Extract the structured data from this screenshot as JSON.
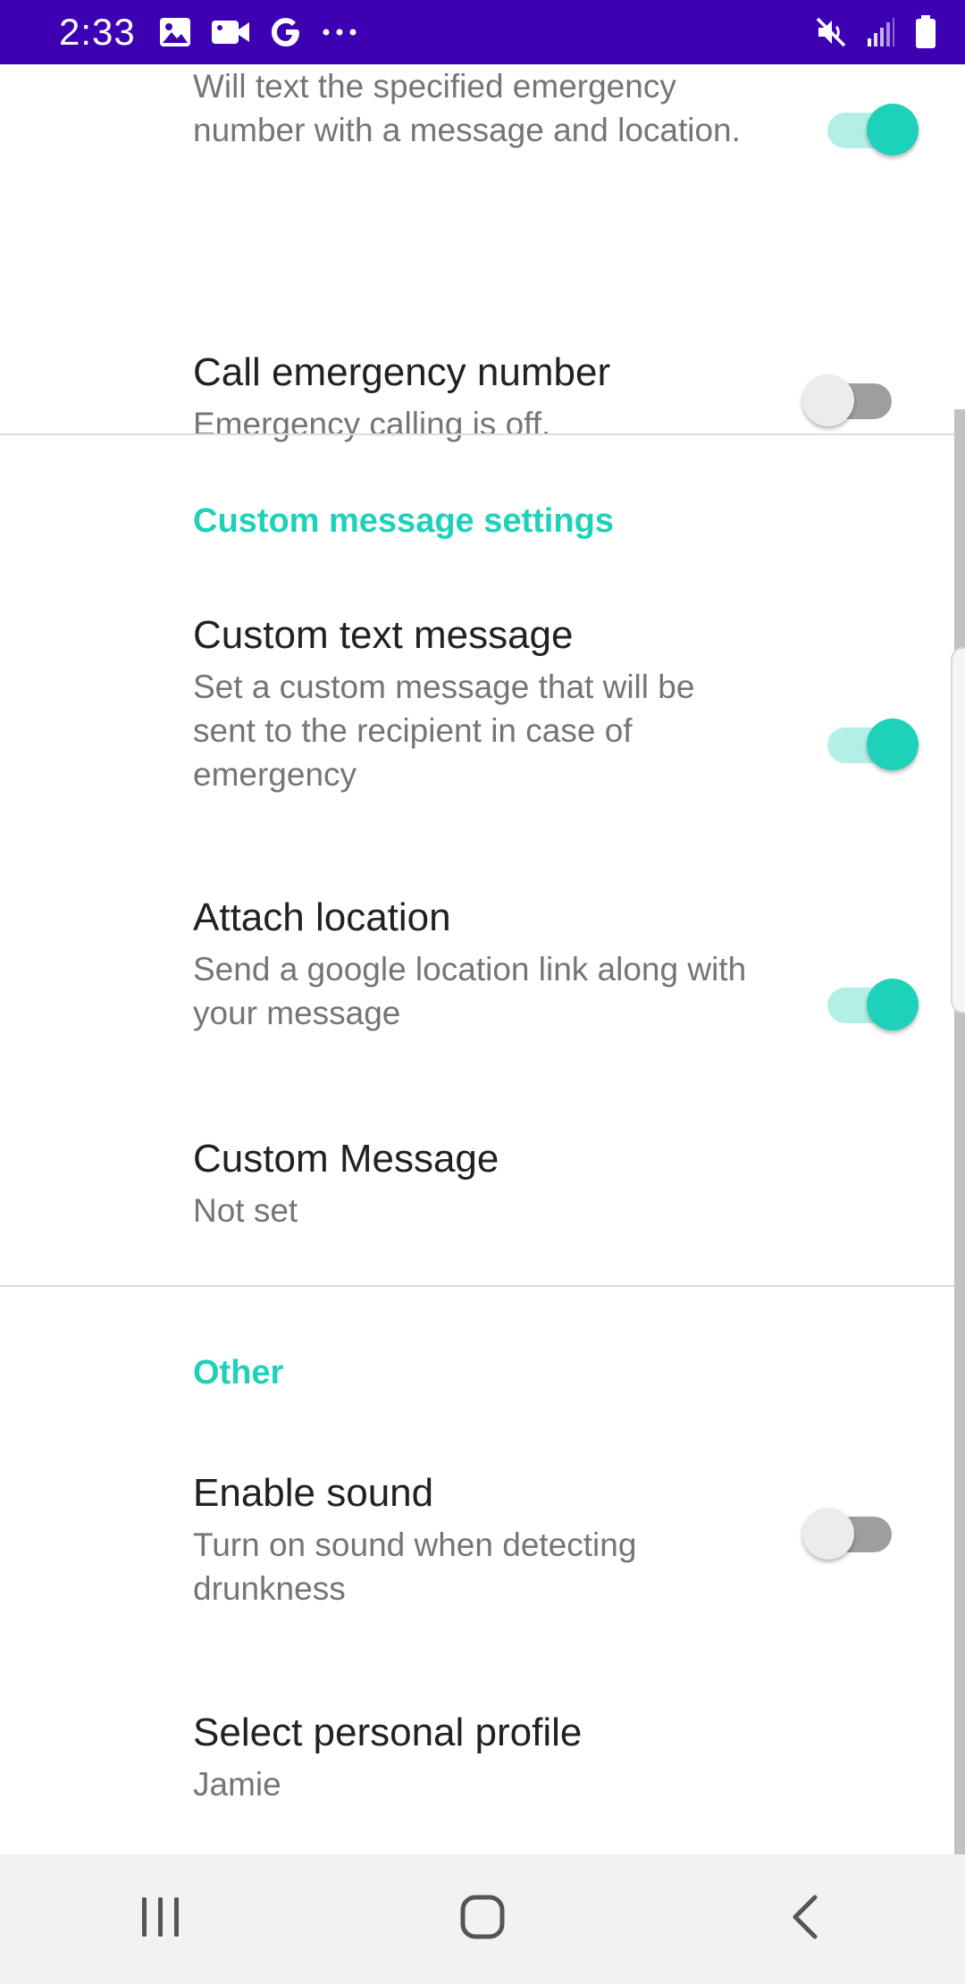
{
  "status_bar": {
    "time": "2:33",
    "left_icons": [
      "image-icon",
      "video-icon",
      "google-icon",
      "more-icon"
    ],
    "right_icons": [
      "mute-icon",
      "signal-icon",
      "battery-icon"
    ],
    "background_color": "#3d01b3"
  },
  "accent_color": "#1ed1b9",
  "emergency": {
    "text_summary": "Will text the specified emergency number with a message and location.",
    "text_switch_on": true,
    "call_title": "Call emergency number",
    "call_summary": "Emergency calling is off.",
    "call_switch_on": false
  },
  "custom_message_settings": {
    "header": "Custom message settings",
    "custom_text": {
      "title": "Custom text message",
      "summary": "Set a custom message that will be sent to the recipient in case of emergency",
      "switch_on": true
    },
    "attach_location": {
      "title": "Attach location",
      "summary": "Send a google location link along with your message",
      "switch_on": true
    },
    "custom_message": {
      "title": "Custom Message",
      "summary": "Not set"
    }
  },
  "other": {
    "header": "Other",
    "enable_sound": {
      "title": "Enable sound",
      "summary": "Turn on sound when detecting drunkness",
      "switch_on": false
    },
    "personal_profile": {
      "title": "Select personal profile",
      "summary": "Jamie"
    }
  },
  "nav_bar": {
    "buttons": [
      "recents-icon",
      "home-icon",
      "back-icon"
    ]
  }
}
